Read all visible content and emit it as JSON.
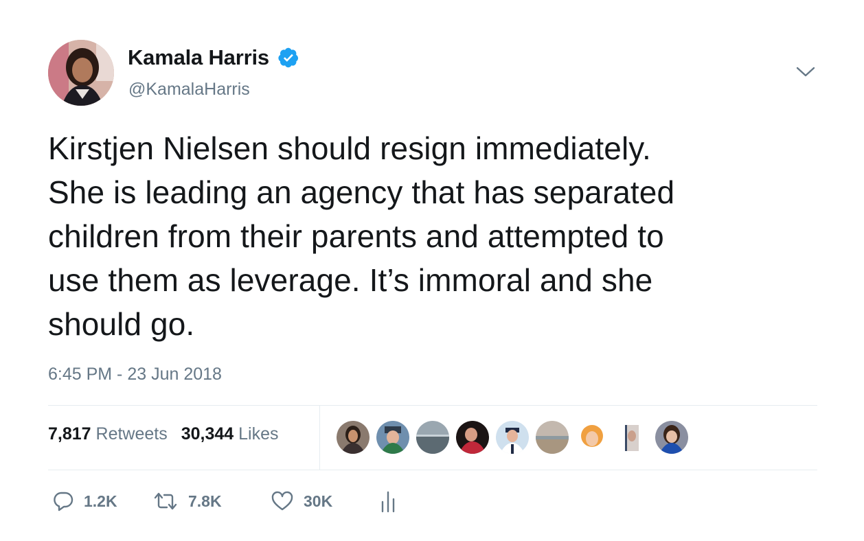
{
  "author": {
    "name": "Kamala Harris",
    "handle": "@KamalaHarris",
    "verified": true
  },
  "tweet": {
    "text": "Kirstjen Nielsen should resign immediately.\nShe is leading an agency that has separated\nchildren from their parents and attempted to\nuse them as leverage. It’s immoral and she\nshould go.",
    "timestamp": "6:45 PM - 23 Jun 2018"
  },
  "stats": {
    "retweets_count": "7,817",
    "retweets_label": "Retweets",
    "likes_count": "30,344",
    "likes_label": "Likes"
  },
  "actions": {
    "reply_count": "1.2K",
    "retweet_count": "7.8K",
    "like_count": "30K"
  },
  "icons": {
    "verified": "verified-badge-icon",
    "menu": "chevron-down-icon",
    "reply": "reply-icon",
    "retweet": "retweet-icon",
    "like": "heart-icon",
    "analytics": "analytics-icon"
  },
  "colors": {
    "accent": "#1da1f2",
    "text": "#14171a",
    "muted": "#657786",
    "divider": "#e6ecf0"
  }
}
